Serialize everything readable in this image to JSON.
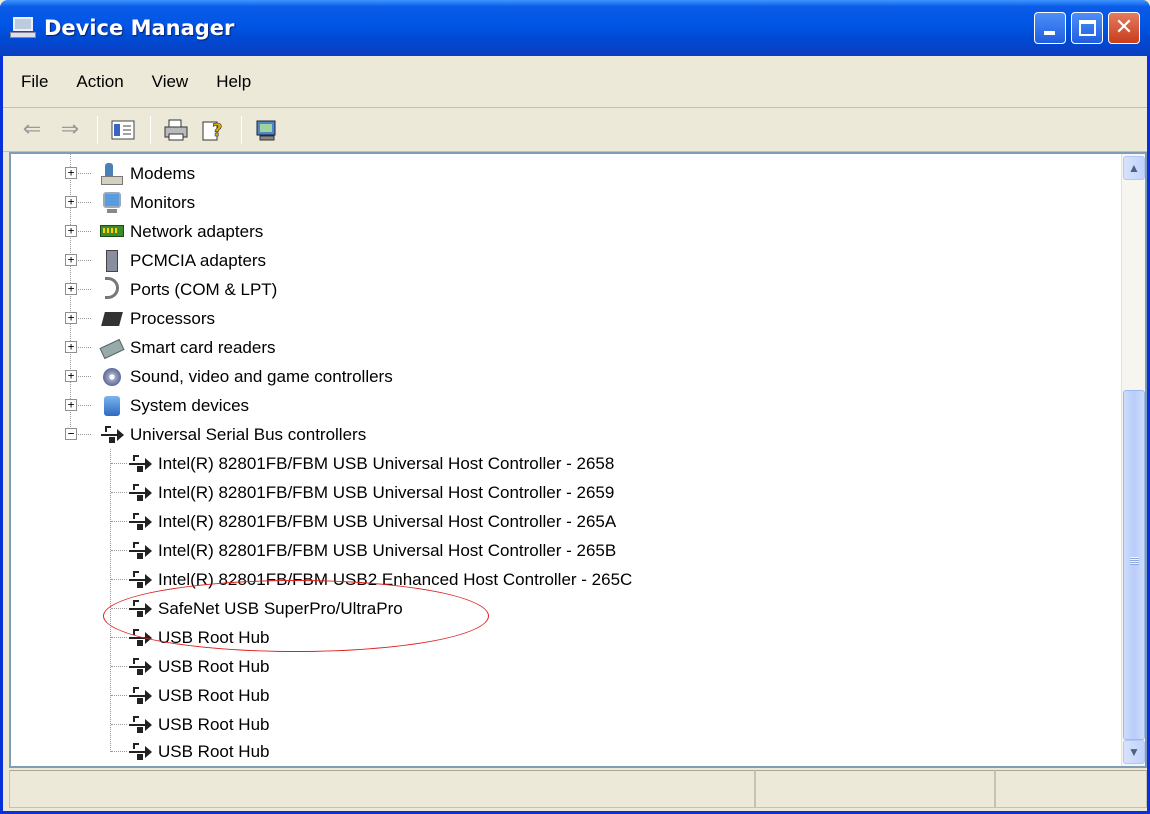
{
  "window": {
    "title": "Device Manager"
  },
  "menu": [
    {
      "label": "File"
    },
    {
      "label": "Action"
    },
    {
      "label": "View"
    },
    {
      "label": "Help"
    }
  ],
  "toolbar": {
    "icons": [
      "back-arrow-icon",
      "forward-arrow-icon",
      "properties-icon",
      "print-icon",
      "help-icon",
      "scan-hardware-icon"
    ]
  },
  "tree": {
    "categories": [
      {
        "label": "Modems",
        "icon": "modem-icon",
        "expanded": false
      },
      {
        "label": "Monitors",
        "icon": "monitor-icon",
        "expanded": false
      },
      {
        "label": "Network adapters",
        "icon": "network-adapter-icon",
        "expanded": false
      },
      {
        "label": "PCMCIA adapters",
        "icon": "pcmcia-icon",
        "expanded": false
      },
      {
        "label": "Ports (COM & LPT)",
        "icon": "port-icon",
        "expanded": false
      },
      {
        "label": "Processors",
        "icon": "processor-icon",
        "expanded": false
      },
      {
        "label": "Smart card readers",
        "icon": "smart-card-icon",
        "expanded": false
      },
      {
        "label": "Sound, video and game controllers",
        "icon": "sound-icon",
        "expanded": false
      },
      {
        "label": "System devices",
        "icon": "system-device-icon",
        "expanded": false
      },
      {
        "label": "Universal Serial Bus controllers",
        "icon": "usb-icon",
        "expanded": true
      }
    ],
    "usb_devices": [
      {
        "label": "Intel(R) 82801FB/FBM USB Universal Host Controller - 2658"
      },
      {
        "label": "Intel(R) 82801FB/FBM USB Universal Host Controller - 2659"
      },
      {
        "label": "Intel(R) 82801FB/FBM USB Universal Host Controller - 265A"
      },
      {
        "label": "Intel(R) 82801FB/FBM USB Universal Host Controller - 265B"
      },
      {
        "label": "Intel(R) 82801FB/FBM USB2 Enhanced Host Controller - 265C"
      },
      {
        "label": "SafeNet USB SuperPro/UltraPro",
        "highlighted": true
      },
      {
        "label": "USB Root Hub"
      },
      {
        "label": "USB Root Hub"
      },
      {
        "label": "USB Root Hub"
      },
      {
        "label": "USB Root Hub"
      },
      {
        "label": "USB Root Hub"
      }
    ]
  },
  "colors": {
    "titlebar": "#0055e5",
    "annotation": "#dd2222",
    "window_bg": "#ece9d8"
  }
}
